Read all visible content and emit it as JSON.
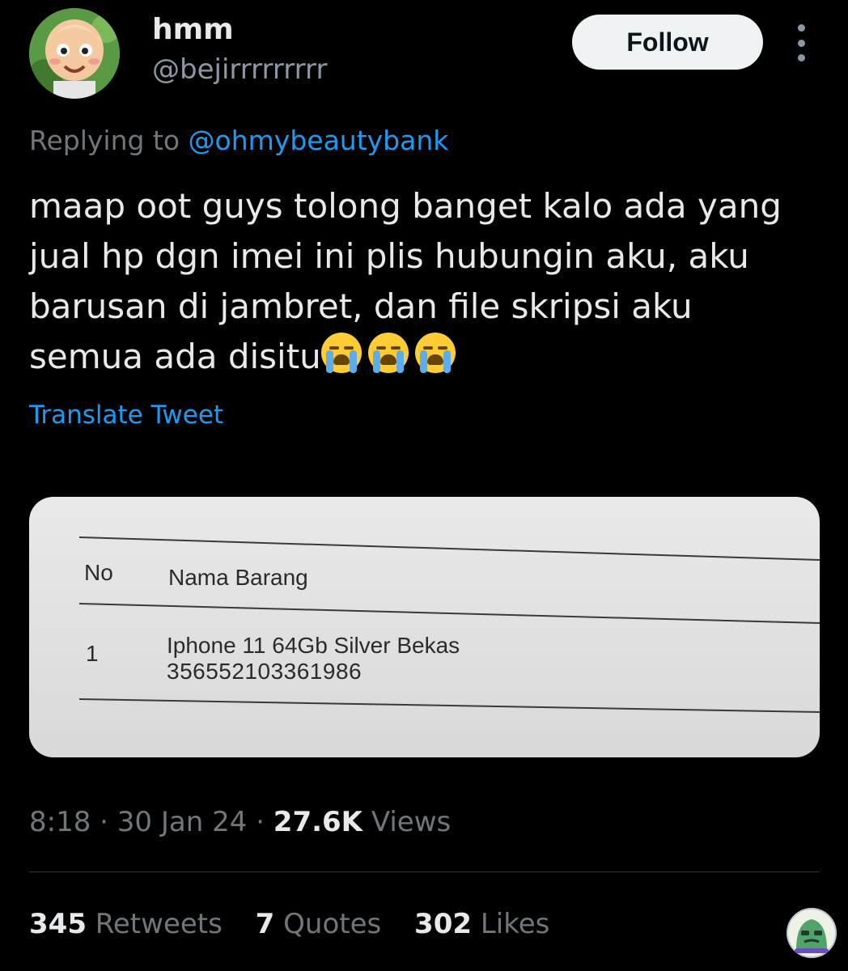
{
  "author": {
    "display_name": "hmm",
    "handle": "@bejirrrrrrrrr",
    "avatar_icon": "cartoon-boy-avatar-icon"
  },
  "follow_label": "Follow",
  "more_icon": "more-vertical-icon",
  "reply": {
    "prefix": "Replying to",
    "mention": "@ohmybeautybank"
  },
  "tweet": {
    "lines": [
      "maap oot guys tolong banget kalo ada yang",
      "jual hp dgn imei ini plis hubungin aku, aku",
      "barusan di jambret, dan file skripsi aku",
      "semua ada disitu"
    ],
    "emoji_icon": "loudly-crying-face-icon",
    "emoji_count": 3
  },
  "translate_label": "Translate Tweet",
  "media": {
    "col_no": "No",
    "col_name": "Nama Barang",
    "row_no": "1",
    "item_name": "Iphone 11 64Gb Silver Bekas",
    "imei": "356552103361986"
  },
  "meta": {
    "time": "8:18",
    "sep1": "·",
    "date": "30 Jan 24",
    "sep2": "·",
    "views_count": "27.6K",
    "views_label": "Views"
  },
  "stats": {
    "retweets_count": "345",
    "retweets_label": "Retweets",
    "quotes_count": "7",
    "quotes_label": "Quotes",
    "likes_count": "302",
    "likes_label": "Likes"
  },
  "corner_icon": "green-character-sticker-icon",
  "colors": {
    "background": "#000000",
    "primary_text": "#e7e9ea",
    "secondary_text": "#71767b",
    "link_blue": "#1d9bf0",
    "follow_button_bg": "#eff3f4"
  }
}
